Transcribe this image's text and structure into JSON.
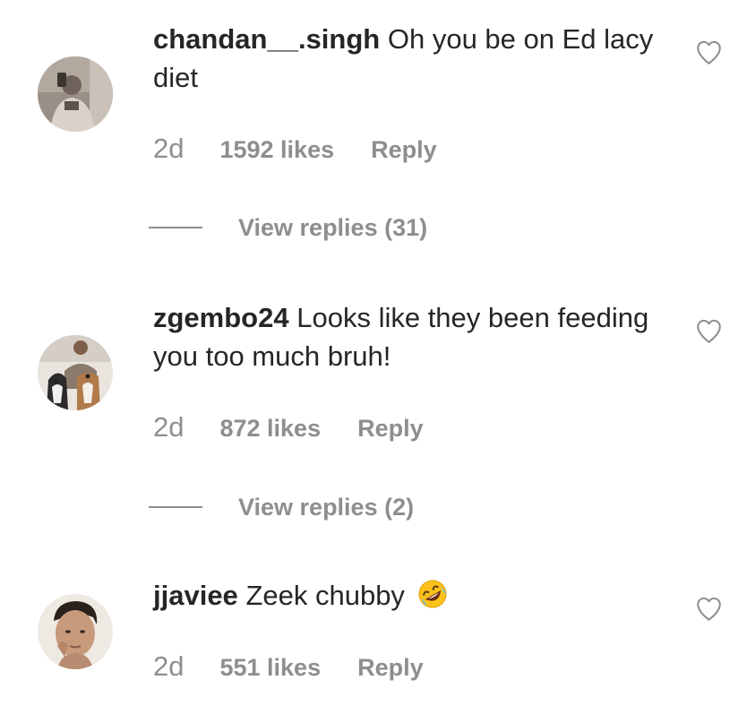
{
  "comments": [
    {
      "username": "chandan__.singh",
      "text": "Oh you be on Ed lacy diet",
      "time": "2d",
      "likes": "1592 likes",
      "reply_label": "Reply",
      "view_replies": "View replies (31)"
    },
    {
      "username": "zgembo24",
      "text": "Looks like they been feeding you too much bruh!",
      "time": "2d",
      "likes": "872 likes",
      "reply_label": "Reply",
      "view_replies": "View replies (2)"
    },
    {
      "username": "jjaviee",
      "text": "Zeek chubby",
      "emoji": "rolling-on-floor-laughing-emoji",
      "time": "2d",
      "likes": "551 likes",
      "reply_label": "Reply"
    }
  ],
  "icons": {
    "like": "heart-outline-icon"
  },
  "colors": {
    "primary_text": "#262626",
    "secondary_text": "#8e8e8e",
    "background": "#ffffff"
  }
}
